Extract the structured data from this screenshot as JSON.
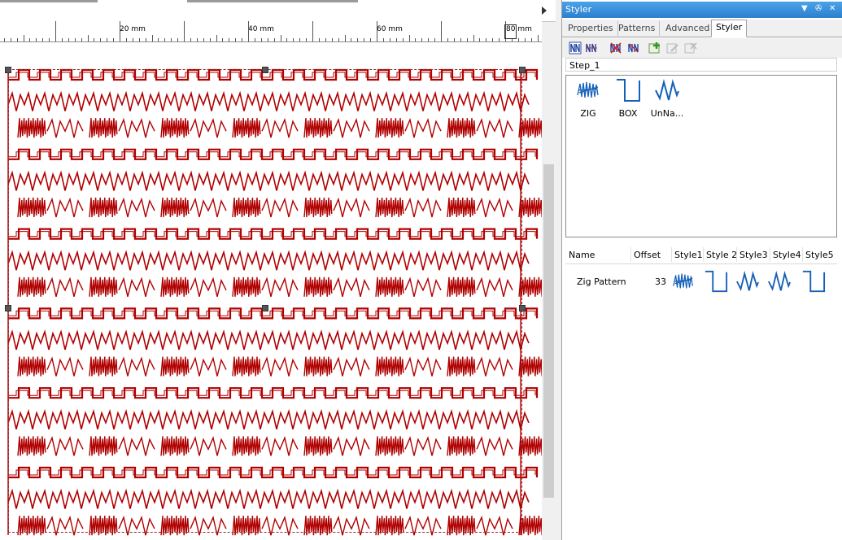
{
  "ruler": {
    "labels": [
      "20 mm",
      "40 mm",
      "60 mm",
      "80 mm"
    ]
  },
  "colors": {
    "stitch": "#b00000",
    "accent": "#2d7fce",
    "icon_blue": "#1560b8"
  },
  "panel": {
    "title": "Styler",
    "tabs": [
      "Properties",
      "Patterns",
      "Advanced",
      "Styler"
    ],
    "active_tab": "Styler",
    "step_name": "Step_1",
    "styles": [
      {
        "label": "ZIG",
        "icon": "zig-scribble-icon"
      },
      {
        "label": "BOX",
        "icon": "box-square-wave-icon"
      },
      {
        "label": "UnNa...",
        "icon": "zigzag-wave-icon"
      }
    ],
    "grid": {
      "columns": [
        "Name",
        "Offset",
        "Style1",
        "Style 2",
        "Style3",
        "Style4",
        "Style5"
      ],
      "rows": [
        {
          "name": "Zig Pattern",
          "offset": "33",
          "styles": [
            "zig-scribble-icon",
            "box-square-wave-icon",
            "zigzag-wave-icon",
            "zigzag-wave-icon",
            "box-square-wave-icon"
          ]
        }
      ]
    }
  }
}
